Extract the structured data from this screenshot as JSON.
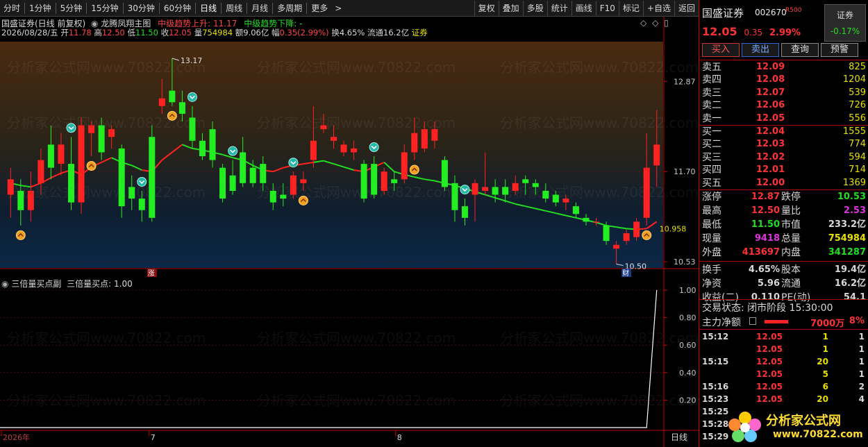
{
  "toolbar": {
    "periods": [
      "分时",
      "1分钟",
      "5分钟",
      "15分钟",
      "30分钟",
      "60分钟",
      "日线",
      "周线",
      "月线",
      "多周期",
      "更多"
    ],
    "active_period": "日线",
    "more_arrow": ">",
    "tools": [
      "复权",
      "叠加",
      "多股",
      "统计",
      "画线",
      "F10",
      "标记",
      "+自选",
      "返回"
    ]
  },
  "chart_header": {
    "stock": "国盛证券(日线 前复权)",
    "indicator": "龙腾凤翔主图",
    "trend_up": "中级趋势上升: 11.17",
    "trend_down": "中级趋势下降: -",
    "info_date": "2026/08/28/五",
    "info_open_label": "开",
    "info_open": "11.78",
    "info_high_label": "高",
    "info_high": "12.50",
    "info_low_label": "低",
    "info_low": "11.50",
    "info_close_label": "收",
    "info_close": "12.05",
    "info_vol_label": "量",
    "info_vol": "754984",
    "info_amt_label": "额",
    "info_amt": "9.06亿",
    "info_range_label": "幅",
    "info_range": "0.35(2.99%)",
    "info_turn_label": "换",
    "info_turn": "4.65%",
    "info_float_label": "流通",
    "info_float": "16.2亿",
    "info_sector": "证券"
  },
  "sub_header": {
    "name": "三倍量买点副",
    "value_text": "三倍量买点: 1.00"
  },
  "axis": {
    "main_ticks": [
      "12.87",
      "11.70",
      "10.53"
    ],
    "sub_ticks": [
      "1.00",
      "0.80",
      "0.60",
      "0.40",
      "0.20"
    ],
    "date_labels": [
      "2026年",
      "7",
      "8"
    ],
    "period_label": "日线",
    "high_mark": "13.17",
    "low_mark": "10.50",
    "last_value": "10.958",
    "rise_tag": "涨",
    "finance_tag": "财"
  },
  "watermark": "分析家公式网www.70822.com",
  "logo": {
    "name": "分析家公式网",
    "url": "www.70822.com"
  },
  "chart_data": {
    "type": "candlestick",
    "ylim": [
      10.45,
      13.35
    ],
    "candles": [
      {
        "o": 11.4,
        "c": 11.6,
        "h": 11.75,
        "l": 11.1
      },
      {
        "o": 11.45,
        "c": 11.2,
        "h": 11.6,
        "l": 11.0
      },
      {
        "o": 11.2,
        "c": 11.45,
        "h": 11.7,
        "l": 11.05
      },
      {
        "o": 11.55,
        "c": 11.85,
        "h": 12.0,
        "l": 11.4
      },
      {
        "o": 12.05,
        "c": 11.75,
        "h": 12.3,
        "l": 11.6
      },
      {
        "o": 11.8,
        "c": 12.05,
        "h": 12.2,
        "l": 11.65
      },
      {
        "o": 11.8,
        "c": 11.3,
        "h": 12.15,
        "l": 11.2
      },
      {
        "o": 11.3,
        "c": 12.3,
        "h": 12.4,
        "l": 11.15
      },
      {
        "o": 12.2,
        "c": 12.3,
        "h": 12.35,
        "l": 11.9
      },
      {
        "o": 12.3,
        "c": 11.95,
        "h": 12.4,
        "l": 11.85
      },
      {
        "o": 12.15,
        "c": 12.25,
        "h": 12.3,
        "l": 12.0
      },
      {
        "o": 12.0,
        "c": 11.25,
        "h": 12.05,
        "l": 11.1
      },
      {
        "o": 11.5,
        "c": 11.35,
        "h": 11.65,
        "l": 11.2
      },
      {
        "o": 11.35,
        "c": 11.2,
        "h": 11.45,
        "l": 11.05
      },
      {
        "o": 12.15,
        "c": 11.1,
        "h": 12.3,
        "l": 11.05
      },
      {
        "o": 12.55,
        "c": 12.65,
        "h": 12.9,
        "l": 12.45
      },
      {
        "o": 12.75,
        "c": 12.6,
        "h": 13.17,
        "l": 12.55
      },
      {
        "o": 12.6,
        "c": 12.45,
        "h": 12.75,
        "l": 12.35
      },
      {
        "o": 12.4,
        "c": 12.1,
        "h": 12.55,
        "l": 12.0
      },
      {
        "o": 12.1,
        "c": 11.9,
        "h": 12.2,
        "l": 11.85
      },
      {
        "o": 12.25,
        "c": 11.85,
        "h": 12.35,
        "l": 11.75
      },
      {
        "o": 11.75,
        "c": 11.35,
        "h": 11.8,
        "l": 11.3
      },
      {
        "o": 11.65,
        "c": 11.45,
        "h": 11.85,
        "l": 11.4
      },
      {
        "o": 11.95,
        "c": 11.55,
        "h": 12.15,
        "l": 11.5
      },
      {
        "o": 11.75,
        "c": 11.55,
        "h": 11.85,
        "l": 11.5
      },
      {
        "o": 11.8,
        "c": 11.55,
        "h": 11.9,
        "l": 11.45
      },
      {
        "o": 11.45,
        "c": 11.3,
        "h": 11.55,
        "l": 11.2
      },
      {
        "o": 11.4,
        "c": 11.35,
        "h": 11.55,
        "l": 11.25
      },
      {
        "o": 11.4,
        "c": 11.65,
        "h": 11.7,
        "l": 11.35
      },
      {
        "o": 11.55,
        "c": 11.6,
        "h": 11.7,
        "l": 11.45
      },
      {
        "o": 11.85,
        "c": 12.1,
        "h": 12.55,
        "l": 11.75
      },
      {
        "o": 12.25,
        "c": 12.3,
        "h": 12.45,
        "l": 12.2
      },
      {
        "o": 12.1,
        "c": 12.15,
        "h": 12.3,
        "l": 12.0
      },
      {
        "o": 11.95,
        "c": 12.05,
        "h": 12.1,
        "l": 11.9
      },
      {
        "o": 11.95,
        "c": 12.0,
        "h": 12.1,
        "l": 11.85
      },
      {
        "o": 11.8,
        "c": 11.35,
        "h": 11.85,
        "l": 11.3
      },
      {
        "o": 11.8,
        "c": 11.4,
        "h": 11.9,
        "l": 11.35
      },
      {
        "o": 11.45,
        "c": 11.7,
        "h": 11.75,
        "l": 11.4
      },
      {
        "o": 11.6,
        "c": 11.55,
        "h": 11.7,
        "l": 11.45
      },
      {
        "o": 11.6,
        "c": 11.95,
        "h": 12.05,
        "l": 11.55
      },
      {
        "o": 11.95,
        "c": 12.2,
        "h": 12.4,
        "l": 11.85
      },
      {
        "o": 12.0,
        "c": 12.25,
        "h": 12.35,
        "l": 11.95
      },
      {
        "o": 12.1,
        "c": 12.25,
        "h": 12.35,
        "l": 12.0
      },
      {
        "o": 11.85,
        "c": 11.5,
        "h": 11.9,
        "l": 11.45
      },
      {
        "o": 11.55,
        "c": 11.2,
        "h": 11.65,
        "l": 11.05
      },
      {
        "o": 11.25,
        "c": 11.1,
        "h": 11.35,
        "l": 11.0
      },
      {
        "o": 11.4,
        "c": 11.55,
        "h": 11.6,
        "l": 11.05
      },
      {
        "o": 11.45,
        "c": 11.5,
        "h": 11.95,
        "l": 11.4
      },
      {
        "o": 11.5,
        "c": 11.4,
        "h": 11.6,
        "l": 11.3
      },
      {
        "o": 11.5,
        "c": 11.4,
        "h": 11.6,
        "l": 11.3
      },
      {
        "o": 11.45,
        "c": 11.55,
        "h": 11.65,
        "l": 11.4
      },
      {
        "o": 11.6,
        "c": 11.55,
        "h": 11.65,
        "l": 11.4
      },
      {
        "o": 11.55,
        "c": 11.5,
        "h": 11.6,
        "l": 11.4
      },
      {
        "o": 11.45,
        "c": 11.35,
        "h": 11.55,
        "l": 11.3
      },
      {
        "o": 11.4,
        "c": 11.3,
        "h": 11.45,
        "l": 11.25
      },
      {
        "o": 11.3,
        "c": 11.35,
        "h": 11.4,
        "l": 11.2
      },
      {
        "o": 11.25,
        "c": 11.15,
        "h": 11.3,
        "l": 11.1
      },
      {
        "o": 11.1,
        "c": 11.05,
        "h": 11.15,
        "l": 11.0
      },
      {
        "o": 11.05,
        "c": 11.05,
        "h": 11.1,
        "l": 11.0
      },
      {
        "o": 11.0,
        "c": 10.8,
        "h": 11.05,
        "l": 10.75
      },
      {
        "o": 10.7,
        "c": 10.75,
        "h": 10.8,
        "l": 10.5
      },
      {
        "o": 10.8,
        "c": 10.9,
        "h": 10.95,
        "l": 10.75
      },
      {
        "o": 10.85,
        "c": 11.05,
        "h": 11.1,
        "l": 10.8
      },
      {
        "o": 11.1,
        "c": 11.75,
        "h": 12.2,
        "l": 11.0
      },
      {
        "o": 11.78,
        "c": 12.05,
        "h": 12.5,
        "l": 11.5
      }
    ],
    "trend_line": [
      {
        "i": 0,
        "v": 11.55,
        "up": false
      },
      {
        "i": 1,
        "v": 11.52,
        "up": false
      },
      {
        "i": 2,
        "v": 11.5,
        "up": false
      },
      {
        "i": 3,
        "v": 11.55,
        "up": true
      },
      {
        "i": 4,
        "v": 11.62,
        "up": true
      },
      {
        "i": 5,
        "v": 11.68,
        "up": true
      },
      {
        "i": 6,
        "v": 11.72,
        "up": true
      },
      {
        "i": 7,
        "v": 11.66,
        "up": true
      },
      {
        "i": 8,
        "v": 11.76,
        "up": true
      },
      {
        "i": 9,
        "v": 11.82,
        "up": true
      },
      {
        "i": 10,
        "v": 11.88,
        "up": true
      },
      {
        "i": 11,
        "v": 11.82,
        "up": false
      },
      {
        "i": 12,
        "v": 11.78,
        "up": false
      },
      {
        "i": 13,
        "v": 11.72,
        "up": false
      },
      {
        "i": 14,
        "v": 11.7,
        "up": true
      },
      {
        "i": 15,
        "v": 11.85,
        "up": true
      },
      {
        "i": 16,
        "v": 11.95,
        "up": true
      },
      {
        "i": 17,
        "v": 12.05,
        "up": true
      },
      {
        "i": 18,
        "v": 12.0,
        "up": false
      },
      {
        "i": 19,
        "v": 11.98,
        "up": false
      },
      {
        "i": 20,
        "v": 11.95,
        "up": false
      },
      {
        "i": 21,
        "v": 11.92,
        "up": false
      },
      {
        "i": 22,
        "v": 11.88,
        "up": false
      },
      {
        "i": 23,
        "v": 11.85,
        "up": false
      },
      {
        "i": 24,
        "v": 11.78,
        "up": false
      },
      {
        "i": 25,
        "v": 11.72,
        "up": false
      },
      {
        "i": 26,
        "v": 11.7,
        "up": true
      },
      {
        "i": 27,
        "v": 11.75,
        "up": true
      },
      {
        "i": 28,
        "v": 11.78,
        "up": true
      },
      {
        "i": 29,
        "v": 11.8,
        "up": true
      },
      {
        "i": 30,
        "v": 11.82,
        "up": true
      },
      {
        "i": 31,
        "v": 11.84,
        "up": false
      },
      {
        "i": 32,
        "v": 11.8,
        "up": false
      },
      {
        "i": 33,
        "v": 11.76,
        "up": false
      },
      {
        "i": 34,
        "v": 11.72,
        "up": false
      },
      {
        "i": 35,
        "v": 11.7,
        "up": true
      },
      {
        "i": 36,
        "v": 11.76,
        "up": true
      },
      {
        "i": 37,
        "v": 11.82,
        "up": true
      },
      {
        "i": 38,
        "v": 11.7,
        "up": false
      },
      {
        "i": 39,
        "v": 11.66,
        "up": false
      },
      {
        "i": 40,
        "v": 11.63,
        "up": false
      },
      {
        "i": 41,
        "v": 11.6,
        "up": false
      },
      {
        "i": 42,
        "v": 11.58,
        "up": false
      },
      {
        "i": 43,
        "v": 11.55,
        "up": false
      },
      {
        "i": 44,
        "v": 11.52,
        "up": false
      },
      {
        "i": 45,
        "v": 11.48,
        "up": false
      },
      {
        "i": 46,
        "v": 11.44,
        "up": false
      },
      {
        "i": 47,
        "v": 11.4,
        "up": false
      },
      {
        "i": 48,
        "v": 11.36,
        "up": false
      },
      {
        "i": 49,
        "v": 11.32,
        "up": false
      },
      {
        "i": 50,
        "v": 11.28,
        "up": false
      },
      {
        "i": 51,
        "v": 11.25,
        "up": false
      },
      {
        "i": 52,
        "v": 11.22,
        "up": false
      },
      {
        "i": 53,
        "v": 11.19,
        "up": false
      },
      {
        "i": 54,
        "v": 11.16,
        "up": false
      },
      {
        "i": 55,
        "v": 11.13,
        "up": false
      },
      {
        "i": 56,
        "v": 11.1,
        "up": false
      },
      {
        "i": 57,
        "v": 11.07,
        "up": false
      },
      {
        "i": 58,
        "v": 11.04,
        "up": false
      },
      {
        "i": 59,
        "v": 11.0,
        "up": false
      },
      {
        "i": 60,
        "v": 10.98,
        "up": false
      },
      {
        "i": 61,
        "v": 10.96,
        "up": false
      },
      {
        "i": 62,
        "v": 10.95,
        "up": false
      },
      {
        "i": 63,
        "v": 10.96,
        "up": true
      },
      {
        "i": 64,
        "v": 11.05,
        "up": true
      }
    ],
    "buy_markers": [
      1,
      8,
      16,
      29,
      40,
      63
    ],
    "sell_markers": [
      6,
      13,
      18,
      22,
      28,
      36,
      45
    ],
    "sub_series": {
      "name": "三倍量买点",
      "values_last_index": 64,
      "value": 1.0,
      "ylim": [
        0,
        1.0
      ]
    }
  },
  "panel": {
    "stock_name": "国盛证券",
    "stock_code": "002670",
    "stock_tag": "R500",
    "sector_name": "证券",
    "sector_change": "-0.17%",
    "price": "12.05",
    "change": "0.35",
    "change_pct": "2.99%",
    "buttons": {
      "buy": "买入",
      "sell": "卖出",
      "query": "查询",
      "alert": "预警"
    },
    "asks": [
      {
        "label": "卖五",
        "price": "12.09",
        "vol": "825"
      },
      {
        "label": "卖四",
        "price": "12.08",
        "vol": "1204"
      },
      {
        "label": "卖三",
        "price": "12.07",
        "vol": "539"
      },
      {
        "label": "卖二",
        "price": "12.06",
        "vol": "726"
      },
      {
        "label": "卖一",
        "price": "12.05",
        "vol": "556"
      }
    ],
    "bids": [
      {
        "label": "买一",
        "price": "12.04",
        "vol": "1555"
      },
      {
        "label": "买二",
        "price": "12.03",
        "vol": "774"
      },
      {
        "label": "买三",
        "price": "12.02",
        "vol": "594"
      },
      {
        "label": "买四",
        "price": "12.01",
        "vol": "714"
      },
      {
        "label": "买五",
        "price": "12.00",
        "vol": "1369"
      }
    ],
    "stats1": [
      {
        "l1": "涨停",
        "v1": "12.87",
        "c1": "#ff3333",
        "l2": "跌停",
        "v2": "10.53",
        "c2": "#22dd22"
      },
      {
        "l1": "最高",
        "v1": "12.50",
        "c1": "#ff3333",
        "l2": "量比",
        "v2": "2.53",
        "c2": "#dd33dd"
      },
      {
        "l1": "最低",
        "v1": "11.50",
        "c1": "#22dd22",
        "l2": "市值",
        "v2": "233.2亿",
        "c2": "#d8d8d8"
      },
      {
        "l1": "现量",
        "v1": "9418",
        "c1": "#dd33dd",
        "l2": "总量",
        "v2": "754984",
        "c2": "#e8e000"
      },
      {
        "l1": "外盘",
        "v1": "413697",
        "c1": "#ff3333",
        "l2": "内盘",
        "v2": "341287",
        "c2": "#22dd22"
      }
    ],
    "stats2": [
      {
        "l1": "换手",
        "v1": "4.65%",
        "c1": "#d8d8d8",
        "l2": "股本",
        "v2": "19.4亿",
        "c2": "#d8d8d8"
      },
      {
        "l1": "净资",
        "v1": "5.96",
        "c1": "#d8d8d8",
        "l2": "流通",
        "v2": "16.2亿",
        "c2": "#d8d8d8"
      },
      {
        "l1": "收益(二)",
        "v1": "0.110",
        "c1": "#d8d8d8",
        "l2": "PE(动)",
        "v2": "54.1",
        "c2": "#d8d8d8"
      }
    ],
    "trade_status": "交易状态: 闭市阶段 15:30:00",
    "main_flow_label": "主力净额",
    "main_flow_value": "7000万",
    "main_flow_pct": "8%",
    "ticks": [
      {
        "t": "15:12",
        "p": "12.05",
        "v": "1",
        "n": "1"
      },
      {
        "t": "",
        "p": "12.05",
        "v": "1",
        "n": "1"
      },
      {
        "t": "15:15",
        "p": "12.05",
        "v": "20",
        "n": "1"
      },
      {
        "t": "",
        "p": "12.05",
        "v": "5",
        "n": "1"
      },
      {
        "t": "15:16",
        "p": "12.05",
        "v": "6",
        "n": "2"
      },
      {
        "t": "15:23",
        "p": "12.05",
        "v": "20",
        "n": "4"
      },
      {
        "t": "15:25",
        "p": "",
        "v": "",
        "n": ""
      },
      {
        "t": "15:28",
        "p": "",
        "v": "",
        "n": ""
      },
      {
        "t": "15:29",
        "p": "",
        "v": "",
        "n": ""
      }
    ]
  }
}
